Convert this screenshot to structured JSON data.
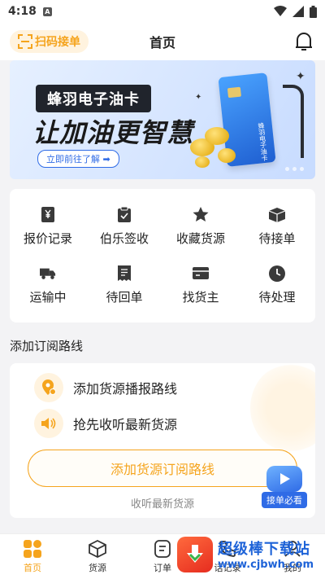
{
  "status_bar": {
    "time": "4:18",
    "badge": "A"
  },
  "header": {
    "scan_label": "扫码接单",
    "title": "首页"
  },
  "banner": {
    "brand": "蜂羽电子油卡",
    "slogan": "让加油更智慧",
    "cta": "立即前往了解 ➡",
    "card_text": "蜂羽电子油卡"
  },
  "grid": [
    {
      "label": "报价记录",
      "icon": "yen-doc-icon"
    },
    {
      "label": "伯乐签收",
      "icon": "sign-doc-icon"
    },
    {
      "label": "收藏货源",
      "icon": "star-icon"
    },
    {
      "label": "待接单",
      "icon": "box-icon"
    },
    {
      "label": "运输中",
      "icon": "truck-icon"
    },
    {
      "label": "待回单",
      "icon": "receipt-icon"
    },
    {
      "label": "找货主",
      "icon": "card-icon"
    },
    {
      "label": "待处理",
      "icon": "clock-icon"
    }
  ],
  "subscribe": {
    "section_title": "添加订阅路线",
    "rows": [
      "添加货源播报路线",
      "抢先收听最新货源"
    ],
    "button": "添加货源订阅路线",
    "hint": "收听最新货源"
  },
  "float_badge": {
    "label": "接单必看"
  },
  "tabs": [
    {
      "label": "首页",
      "icon": "home-grid-icon",
      "active": true
    },
    {
      "label": "货源",
      "icon": "cube-icon",
      "active": false
    },
    {
      "label": "订单",
      "icon": "order-icon",
      "active": false
    },
    {
      "label": "话记录",
      "icon": "phone-icon",
      "active": false
    },
    {
      "label": "我的",
      "icon": "user-icon",
      "active": false
    }
  ],
  "watermark": {
    "title": "超级棒下载站",
    "url": "www.cjbwh.com"
  },
  "colors": {
    "accent": "#f5a41d",
    "accent_bg": "#fff3df",
    "banner_blue": "#2f6be6"
  }
}
